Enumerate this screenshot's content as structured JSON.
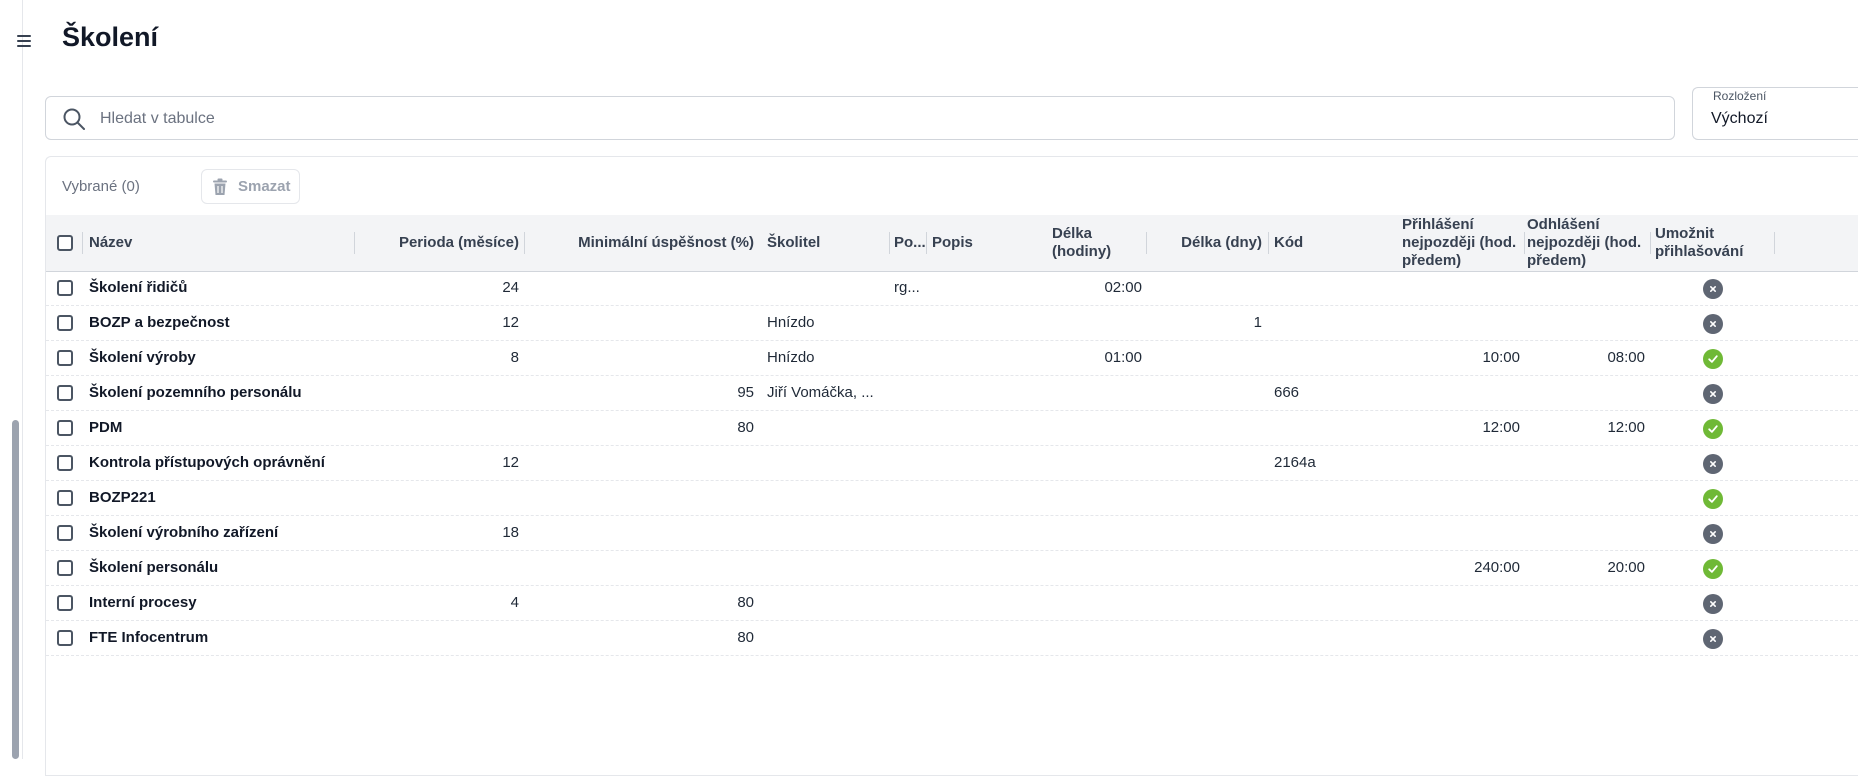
{
  "page": {
    "title": "Školení"
  },
  "search": {
    "placeholder": "Hledat v tabulce"
  },
  "layout": {
    "label": "Rozložení",
    "value": "Výchozí"
  },
  "toolbar": {
    "selected": "Vybrané (0)",
    "delete_label": "Smazat"
  },
  "table": {
    "headers": {
      "name": "Název",
      "period": "Perioda (měsíce)",
      "min_success": "Minimální úspěšnost (%)",
      "trainer": "Školitel",
      "po": "Po...",
      "description": "Popis",
      "hours": "Délka (hodiny)",
      "days": "Délka (dny)",
      "code": "Kód",
      "login_before": "Přihlášení nejpozději (hod. předem)",
      "logout_before": "Odhlášení nejpozději (hod. předem)",
      "allow_login": "Umožnit přihlašování"
    },
    "rows": [
      {
        "name": "Školení řidičů",
        "period": "24",
        "min": "",
        "trainer": "",
        "po": "rg...",
        "desc": "",
        "hours": "02:00",
        "days": "",
        "code": "",
        "login": "",
        "logout": "",
        "allow": false
      },
      {
        "name": "BOZP a bezpečnost",
        "period": "12",
        "min": "",
        "trainer": "Hnízdo",
        "po": "",
        "desc": "",
        "hours": "",
        "days": "1",
        "code": "",
        "login": "",
        "logout": "",
        "allow": false
      },
      {
        "name": "Školení výroby",
        "period": "8",
        "min": "",
        "trainer": "Hnízdo",
        "po": "",
        "desc": "",
        "hours": "01:00",
        "days": "",
        "code": "",
        "login": "10:00",
        "logout": "08:00",
        "allow": true
      },
      {
        "name": "Školení pozemního personálu",
        "period": "",
        "min": "95",
        "trainer": "Jiří Vomáčka, ...",
        "po": "",
        "desc": "",
        "hours": "",
        "days": "",
        "code": "666",
        "login": "",
        "logout": "",
        "allow": false
      },
      {
        "name": "PDM",
        "period": "",
        "min": "80",
        "trainer": "",
        "po": "",
        "desc": "",
        "hours": "",
        "days": "",
        "code": "",
        "login": "12:00",
        "logout": "12:00",
        "allow": true
      },
      {
        "name": "Kontrola přístupových oprávnění",
        "period": "12",
        "min": "",
        "trainer": "",
        "po": "",
        "desc": "",
        "hours": "",
        "days": "",
        "code": "2164a",
        "login": "",
        "logout": "",
        "allow": false
      },
      {
        "name": "BOZP221",
        "period": "",
        "min": "",
        "trainer": "",
        "po": "",
        "desc": "",
        "hours": "",
        "days": "",
        "code": "",
        "login": "",
        "logout": "",
        "allow": true
      },
      {
        "name": "Školení výrobního zařízení",
        "period": "18",
        "min": "",
        "trainer": "",
        "po": "",
        "desc": "",
        "hours": "",
        "days": "",
        "code": "",
        "login": "",
        "logout": "",
        "allow": false
      },
      {
        "name": "Školení personálu",
        "period": "",
        "min": "",
        "trainer": "",
        "po": "",
        "desc": "",
        "hours": "",
        "days": "",
        "code": "",
        "login": "240:00",
        "logout": "20:00",
        "allow": true
      },
      {
        "name": "Interní procesy",
        "period": "4",
        "min": "80",
        "trainer": "",
        "po": "",
        "desc": "",
        "hours": "",
        "days": "",
        "code": "",
        "login": "",
        "logout": "",
        "allow": false
      },
      {
        "name": "FTE Infocentrum",
        "period": "",
        "min": "80",
        "trainer": "",
        "po": "",
        "desc": "",
        "hours": "",
        "days": "",
        "code": "",
        "login": "",
        "logout": "",
        "allow": false
      }
    ]
  },
  "colors": {
    "allowed": "#6fb936",
    "denied": "#5f6673"
  }
}
